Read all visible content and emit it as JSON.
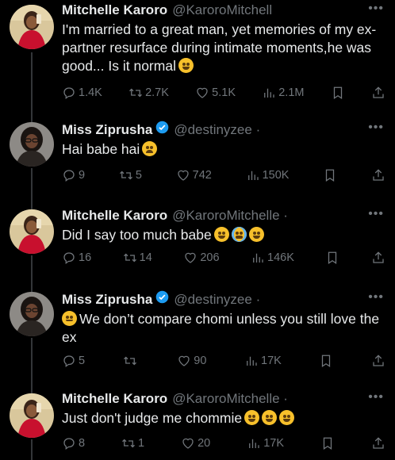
{
  "colors": {
    "background": "#000000",
    "text": "#e7e9ea",
    "muted": "#71767b",
    "verified": "#1d9bf0",
    "avatar_dress": "#c8102e"
  },
  "tweets": [
    {
      "name": "Mitchelle Karoro",
      "handle": "@KaroroMitchell",
      "text": "I'm married to a great man, yet memories of my ex-partner resurface during intimate moments,he was good... Is it normal",
      "emojis": [
        "pleading-face"
      ],
      "replies": "1.4K",
      "retweets": "2.7K",
      "likes": "5.1K",
      "views": "2.1M"
    },
    {
      "name": "Miss Ziprusha",
      "verified": true,
      "handle": "@destinyzee ·",
      "text": "Hai babe hai",
      "emojis": [
        "weary-face"
      ],
      "replies": "9",
      "retweets": "5",
      "likes": "742",
      "views": "150K"
    },
    {
      "name": "Mitchelle Karoro",
      "handle": "@KaroroMitchelle ·",
      "text": "Did I say too much babe",
      "emojis": [
        "pleading-face",
        "loudly-crying-face",
        "tears-of-joy"
      ],
      "replies": "16",
      "retweets": "14",
      "likes": "206",
      "views": "146K"
    },
    {
      "name": "Miss Ziprusha",
      "verified": true,
      "handle": "@destinyzee ·",
      "text": "We don’t compare chomi unless you still love the ex",
      "emojis": [
        "face-with-raised-eyebrow"
      ],
      "replies": "5",
      "retweets": "",
      "likes": "90",
      "views": "17K"
    },
    {
      "name": "Mitchelle Karoro",
      "handle": "@KaroroMitchelle ·",
      "text": "Just don't judge me chommie",
      "emojis": [
        "tears-of-joy",
        "tears-of-joy",
        "tears-of-joy"
      ],
      "replies": "8",
      "retweets": "1",
      "likes": "20",
      "views": "17K"
    }
  ],
  "icons": {
    "more": "more-icon",
    "reply": "reply-icon",
    "retweet": "retweet-icon",
    "like": "like-icon",
    "views": "views-icon",
    "bookmark": "bookmark-icon",
    "share": "share-icon",
    "verified": "verified-badge-icon"
  },
  "more_label": "•••"
}
